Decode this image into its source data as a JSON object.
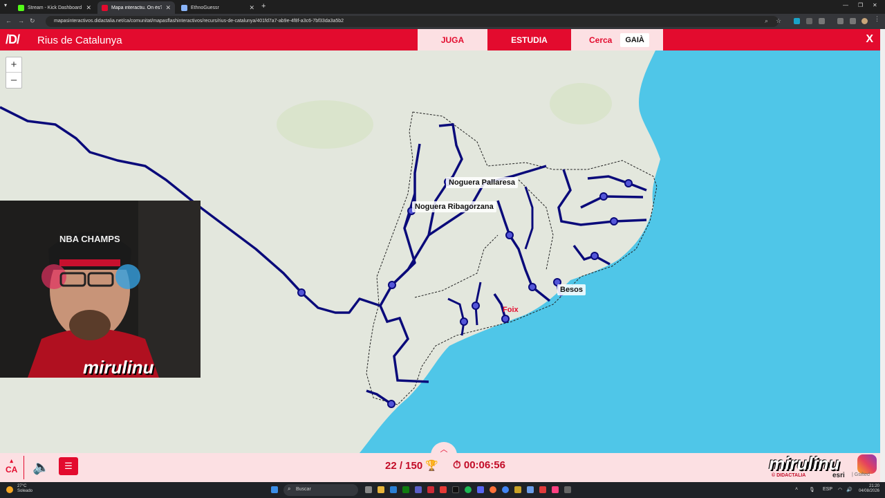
{
  "browser": {
    "tabs": [
      {
        "title": "Stream - Kick Dashboard",
        "active": false,
        "color": "#53fc18"
      },
      {
        "title": "Mapa interactiu. On és? Rius de Catalunya",
        "active": true,
        "color": "#e30b2e"
      },
      {
        "title": "EthnoGuessr",
        "active": false,
        "color": "#8ab4f8"
      }
    ],
    "url": "mapasinteractivos.didactalia.net/ca/comunitat/mapasflashinteractivos/recurs/rius-de-catalunya/401fd7a7-ab9e-4f8f-a3c6-7bf33da3a5b2"
  },
  "app": {
    "logo": "/D/",
    "title": "Rius de Catalunya",
    "tabs": [
      "JUGA",
      "ESTUDIA"
    ],
    "search_label": "Cerca",
    "current_target": "GAIÀ",
    "close": "X"
  },
  "map": {
    "zoom_in": "+",
    "zoom_out": "–",
    "labels": [
      "Noguera Pallaresa",
      "Noguera Ribagorzana",
      "Besos",
      "Foix"
    ]
  },
  "overlay": {
    "streamer_name": "mirulinu",
    "shirt_number": "NBA CHAMPS"
  },
  "footer": {
    "language": "CA",
    "score": "22 / 150",
    "timer": "00:06:56",
    "brand_name": "mirulinu",
    "brand_sub": "© DIDACTALIA",
    "brand_esri": "esri",
    "brand_gsifted": "| Gsifted"
  },
  "taskbar": {
    "temperature": "27°C",
    "weather": "Soleado",
    "search_placeholder": "Buscar",
    "lang": "ESP",
    "time": "21:20",
    "date": "04/08/2026"
  },
  "colors": {
    "brand_red": "#e30b2e",
    "river_blue": "#0a0a7a",
    "sea": "#4fc6e8",
    "land": "#e3e7dd"
  }
}
